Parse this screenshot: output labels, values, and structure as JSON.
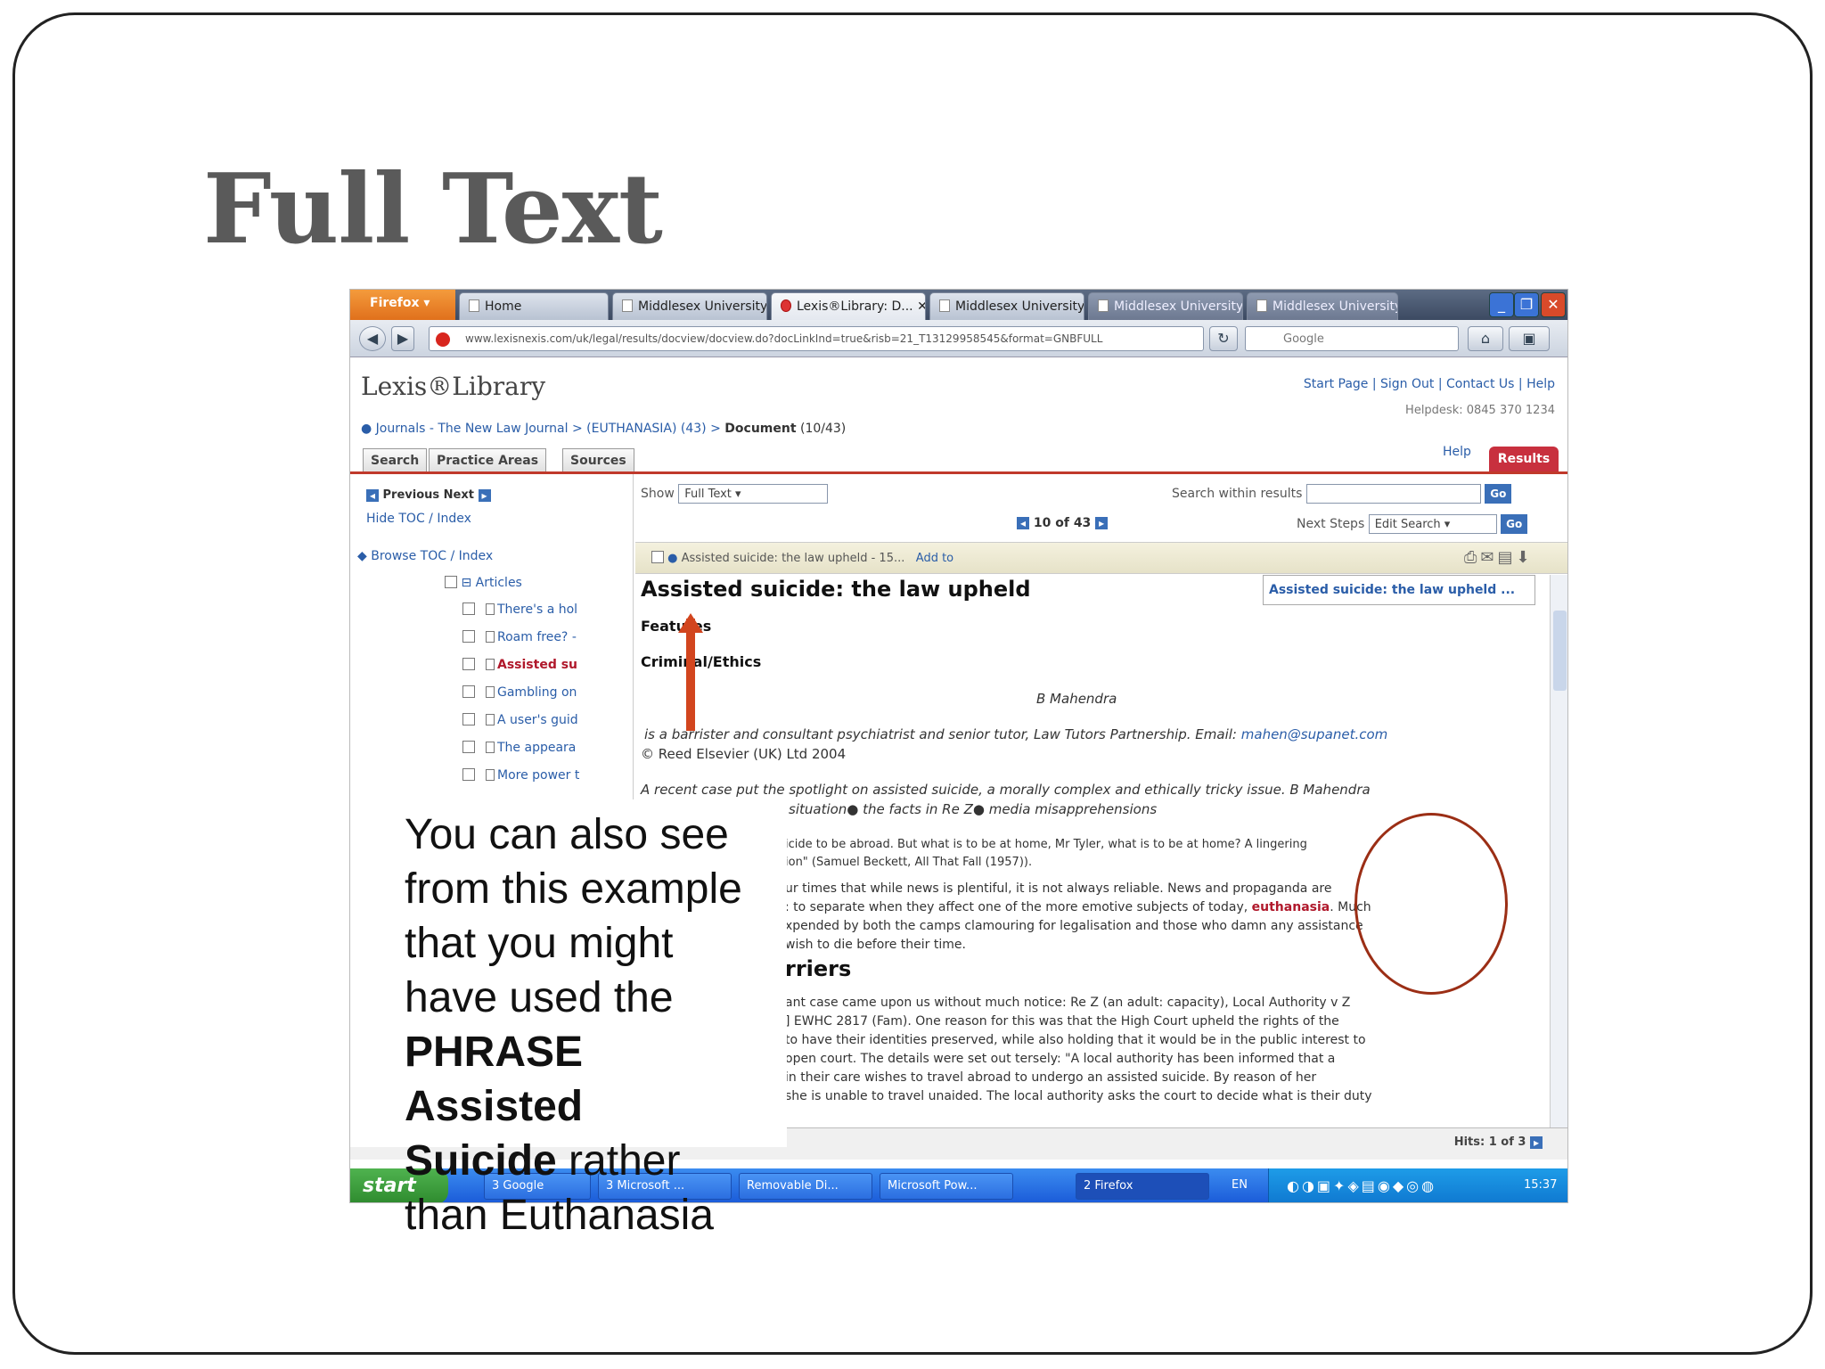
{
  "slide": {
    "title": "Full Text",
    "callout": {
      "lines": [
        "You can also see",
        "from this example",
        "that you might",
        "have used the"
      ],
      "bold1": "PHRASE",
      "bold2": "Assisted",
      "bold3": "Suicide",
      "rest1": " rather",
      "rest2": "than Euthanasia"
    }
  },
  "browser": {
    "firefox_label": "Firefox",
    "tabs": [
      "Home",
      "Middlesex University",
      "Lexis®Library: D...",
      "Middlesex University",
      "Middlesex University",
      "Middlesex University"
    ],
    "url": "www.lexisnexis.com/uk/legal/results/docview/docview.do?docLinkInd=true&risb=21_T13129958545&format=GNBFULL",
    "search_placeholder": "Google"
  },
  "lexis": {
    "logo": "Lexis®Library",
    "top_links": "Start Page | Sign Out | Contact Us | Help",
    "helpdesk": "Helpdesk: 0845 370 1234",
    "breadcrumb": "Journals - The New Law Journal > (EUTHANASIA) (43) >",
    "breadcrumb_doc": "Document",
    "breadcrumb_count": "(10/43)",
    "menu": [
      "Search",
      "Practice Areas",
      "Sources"
    ],
    "help": "Help",
    "results": "Results",
    "prev_next": "Previous Next",
    "hide_toc": "Hide TOC / Index",
    "browse_toc": "Browse TOC / Index",
    "toc_section": "Articles",
    "toc_items": [
      "There's a hol",
      "Roam free? -",
      "Assisted su",
      "Gambling on",
      "A user's guid",
      "The appeara",
      "More power t"
    ],
    "show_label": "Show",
    "show_value": "Full Text",
    "search_within": "Search within results",
    "go": "Go",
    "pager": "10 of 43",
    "next_steps": "Next Steps",
    "next_steps_value": "Edit Search",
    "strip_title": "Assisted suicide: the law upheld - 15...",
    "add_to": "Add to",
    "side_title": "Assisted suicide: the law upheld ...",
    "hits": "Hits: 1 of 3"
  },
  "document": {
    "title": "Assisted suicide: the law upheld",
    "features": "Features",
    "category": "Criminal/Ethics",
    "author": "B Mahendra",
    "bio": "is a barrister and consultant psychiatrist and senior tutor, Law Tutors Partnership. Email:",
    "email": "mahen@supanet.com",
    "copyright": "© Reed Elsevier (UK) Ltd 2004",
    "intro": "A recent case put the spotlight on assisted suicide, a morally complex and ethically tricky issue. B Mahendra",
    "intro2": "situation●    the facts in Re Z●    media misapprehensions",
    "quote1": "icide to be abroad. But what is to be at home, Mr Tyler, what is to be at home? A lingering",
    "quote2": "ion\" (Samuel Beckett, All That Fall (1957)).",
    "para1": [
      "ur times that while news is plentiful, it is not always reliable. News and propaganda are",
      ": to separate when they affect one of the more emotive subjects of today,",
      "xpended by both the camps clamouring for legalisation and those who damn any assistance",
      "wish to die before their time."
    ],
    "keyword": "euthanasia",
    "after_keyword": ". Much",
    "heading2": "rriers",
    "para2": [
      "ant case came upon us without much notice: Re Z (an adult: capacity), Local Authority v Z",
      "] EWHC 2817 (Fam). One reason for this was that the High Court upheld the rights of the",
      "to have their identities preserved, while also holding that it would be in the public interest to",
      "open court. The details were set out tersely: \"A local authority has been informed that a",
      "in their care wishes to travel abroad to undergo an assisted suicide. By reason of her",
      "she is unable to travel unaided. The local authority asks the court to decide what is their duty"
    ]
  },
  "taskbar": {
    "start": "start",
    "items": [
      "3 Google",
      "3 Microsoft ...",
      "Removable Di...",
      "Microsoft Pow...",
      "2 Firefox"
    ],
    "lang": "EN",
    "time": "15:37"
  }
}
